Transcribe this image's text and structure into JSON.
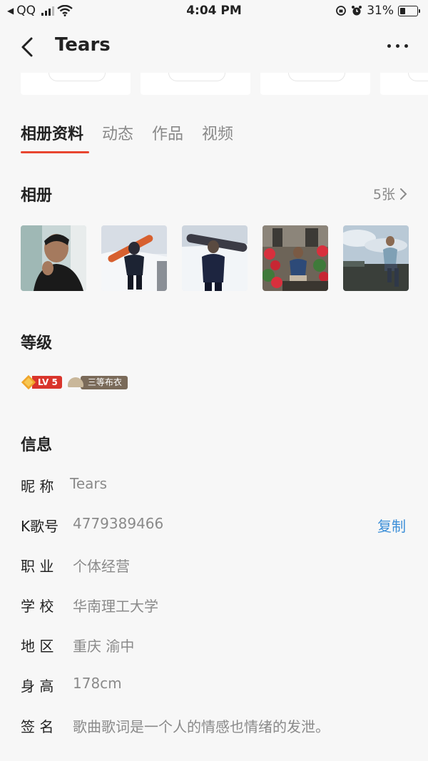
{
  "status_bar": {
    "back_app": "QQ",
    "time": "4:04 PM",
    "battery": "31%",
    "battery_level": 0.31
  },
  "nav": {
    "title": "Tears"
  },
  "tabs": [
    {
      "label": "相册资料",
      "active": true
    },
    {
      "label": "动态",
      "active": false
    },
    {
      "label": "作品",
      "active": false
    },
    {
      "label": "视频",
      "active": false
    }
  ],
  "album": {
    "title": "相册",
    "count": "5张",
    "photos": [
      "photo-portrait",
      "photo-snowboard-1",
      "photo-snowboard-2",
      "photo-flowers",
      "photo-sky"
    ]
  },
  "level": {
    "title": "等级",
    "lv_badge": "LV 5",
    "rank_badge": "三等布衣"
  },
  "info": {
    "title": "信息",
    "rows": [
      {
        "label": "昵 称",
        "value": "Tears"
      },
      {
        "label": "K歌号",
        "value": "4779389466",
        "action": "复制"
      },
      {
        "label": "职 业",
        "value": "个体经营"
      },
      {
        "label": "学 校",
        "value": "华南理工大学"
      },
      {
        "label": "地 区",
        "value": "重庆 渝中"
      },
      {
        "label": "身 高",
        "value": "178cm"
      },
      {
        "label": "签 名",
        "value": "歌曲歌词是一个人的情感也情绪的发泄。"
      }
    ]
  },
  "colors": {
    "accent": "#e8452f",
    "link": "#3d8fd8",
    "muted": "#8a8a8a"
  }
}
